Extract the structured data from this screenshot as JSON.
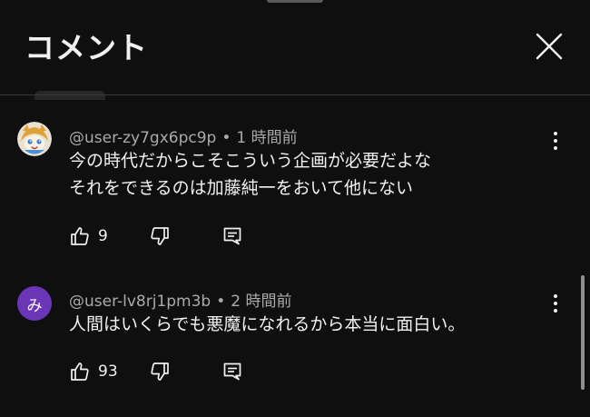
{
  "header": {
    "title": "コメント"
  },
  "comments": [
    {
      "author": "@user-zy7gx6pc9p",
      "time": "1 時間前",
      "lines": [
        "今の時代だからこそこういう企画が必要だよな",
        "それをできるのは加藤純一をおいて他にない"
      ],
      "likes": "9",
      "avatar": "mascot-illustration"
    },
    {
      "author": "@user-lv8rj1pm3b",
      "time": "2 時間前",
      "lines": [
        "人間はいくらでも悪魔になれるから本当に面白い。"
      ],
      "likes": "93",
      "avatar_letter": "み",
      "avatar_color": "#6b35b8"
    }
  ],
  "separator": "•",
  "icons": {
    "close": "close-icon",
    "more": "more-vert-icon",
    "like": "thumb-up-icon",
    "dislike": "thumb-down-icon",
    "reply": "reply-icon"
  }
}
